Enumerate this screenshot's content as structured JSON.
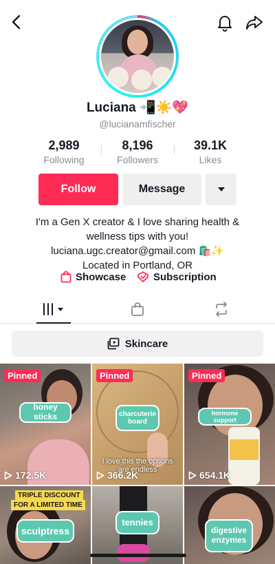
{
  "profile": {
    "name": "Luciana",
    "name_emojis": "📲☀️💖",
    "handle": "@lucianamfischer"
  },
  "stats": [
    {
      "value": "2,989",
      "label": "Following"
    },
    {
      "value": "8,196",
      "label": "Followers"
    },
    {
      "value": "39.1K",
      "label": "Likes"
    }
  ],
  "actions": {
    "follow_label": "Follow",
    "message_label": "Message"
  },
  "bio": {
    "line1": "I'm a Gen X creator & I love sharing health &",
    "line2": "wellness tips with you!",
    "line3": "luciana.ugc.creator@gmail.com 🛍️✨",
    "line4": "Located in Portland, OR"
  },
  "links": {
    "showcase": "Showcase",
    "subscription": "Subscription"
  },
  "playlist": {
    "label": "Skincare"
  },
  "videos": [
    {
      "pinned": "Pinned",
      "caption": "honey sticks",
      "views": "172.5K"
    },
    {
      "pinned": "Pinned",
      "caption": "charcuterie board",
      "overlay": "I love this the options are endless",
      "views": "366.2K"
    },
    {
      "pinned": "Pinned",
      "caption": "hormone support",
      "views": "654.1K"
    },
    {
      "deal_line1": "TRIPLE DISCOUNT",
      "deal_line2": "FOR A LIMITED TIME",
      "caption": "sculptress"
    },
    {
      "caption": "tennies"
    },
    {
      "caption": "digestive enzymes"
    }
  ],
  "colors": {
    "accent": "#fe2c55",
    "bubble": "#5cc8b0",
    "text": "#161823",
    "muted": "#8a8b91"
  }
}
